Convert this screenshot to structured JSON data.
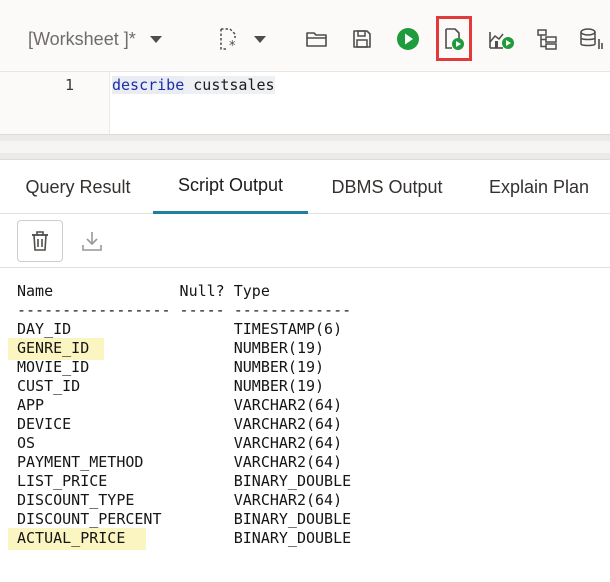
{
  "toolbar": {
    "worksheet_label": "[Worksheet ]*",
    "buttons": [
      "new-file-icon",
      "open-folder-icon",
      "save-icon",
      "run-statement-icon",
      "run-script-icon",
      "autotrace-icon",
      "explain-plan-icon",
      "sql-tuning-icon"
    ],
    "highlight_color": "#e03a3a"
  },
  "editor": {
    "line_number": "1",
    "keyword": "describe",
    "identifier": "custsales"
  },
  "tabs": [
    {
      "label": "Query Result",
      "active": false
    },
    {
      "label": "Script Output",
      "active": true
    },
    {
      "label": "DBMS Output",
      "active": false
    },
    {
      "label": "Explain Plan",
      "active": false
    }
  ],
  "output": {
    "header": "Name              Null? Type",
    "separator": "----------------- ----- -------------",
    "rows": [
      "DAY_ID                  TIMESTAMP(6)",
      "GENRE_ID                NUMBER(19)",
      "MOVIE_ID                NUMBER(19)",
      "CUST_ID                 NUMBER(19)",
      "APP                     VARCHAR2(64)",
      "DEVICE                  VARCHAR2(64)",
      "OS                      VARCHAR2(64)",
      "PAYMENT_METHOD          VARCHAR2(64)",
      "LIST_PRICE              BINARY_DOUBLE",
      "DISCOUNT_TYPE           VARCHAR2(64)",
      "DISCOUNT_PERCENT        BINARY_DOUBLE",
      "ACTUAL_PRICE            BINARY_DOUBLE"
    ],
    "highlight_color": "#fbf5c2"
  },
  "colors": {
    "accent_tab": "#227e9e",
    "run_green": "#1e9b3a"
  }
}
